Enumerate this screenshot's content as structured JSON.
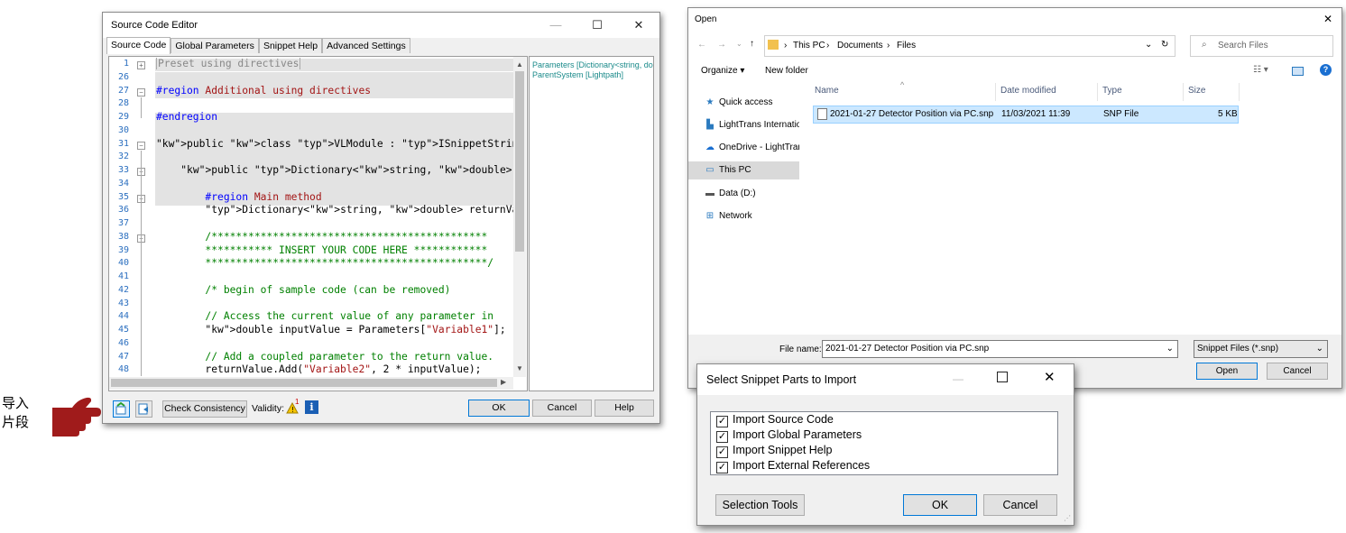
{
  "annotation": {
    "line1": "导入",
    "line2": "片段",
    "pointer_icon": "pointing-hand-icon",
    "pointer_color": "#a01b1b"
  },
  "editor": {
    "title": "Source Code Editor",
    "tabs": [
      "Source Code",
      "Global Parameters",
      "Snippet Help",
      "Advanced Settings"
    ],
    "lines": [
      {
        "n": "1",
        "text": "Preset using directives"
      },
      {
        "n": "26",
        "text": ""
      },
      {
        "n": "27",
        "text": "#region Additional using directives"
      },
      {
        "n": "28",
        "text": ""
      },
      {
        "n": "29",
        "text": "#endregion"
      },
      {
        "n": "30",
        "text": ""
      },
      {
        "n": "31",
        "text": "public class VLModule : ISnippetStringDoubleDictionary_S"
      },
      {
        "n": "32",
        "text": ""
      },
      {
        "n": "33",
        "text": "    public Dictionary<string, double> GetOutputParameter"
      },
      {
        "n": "34",
        "text": ""
      },
      {
        "n": "35",
        "text": "        #region Main method"
      },
      {
        "n": "36",
        "text": "        Dictionary<string, double> returnValue = new Dic"
      },
      {
        "n": "37",
        "text": ""
      },
      {
        "n": "38",
        "text": "        /*********************************************"
      },
      {
        "n": "39",
        "text": "        *********** INSERT YOUR CODE HERE ************"
      },
      {
        "n": "40",
        "text": "        **********************************************/"
      },
      {
        "n": "41",
        "text": ""
      },
      {
        "n": "42",
        "text": "        /* begin of sample code (can be removed)"
      },
      {
        "n": "43",
        "text": ""
      },
      {
        "n": "44",
        "text": "        // Access the current value of any parameter in"
      },
      {
        "n": "45",
        "text": "        double inputValue = Parameters[\"Variable1\"];"
      },
      {
        "n": "46",
        "text": ""
      },
      {
        "n": "47",
        "text": "        // Add a coupled parameter to the return value."
      },
      {
        "n": "48",
        "text": "        returnValue.Add(\"Variable2\", 2 * inputValue);"
      }
    ],
    "right_pane": [
      "Parameters [Dictionary<string, do",
      "ParentSystem [Lightpath]"
    ],
    "check_consistency": "Check Consistency",
    "validity_label": "Validity:",
    "validity_count": "1",
    "ok": "OK",
    "cancel": "Cancel",
    "help": "Help"
  },
  "open_dialog": {
    "title": "Open",
    "breadcrumb": [
      "This PC",
      "Documents",
      "Files"
    ],
    "search_placeholder": "Search Files",
    "organize": "Organize",
    "new_folder": "New folder",
    "sidebar": [
      {
        "label": "Quick access",
        "icon": "star-icon"
      },
      {
        "label": "LightTrans International",
        "icon": "building-icon"
      },
      {
        "label": "OneDrive - LightTrans",
        "icon": "cloud-icon"
      },
      {
        "label": "This PC",
        "icon": "monitor-icon"
      },
      {
        "label": "Data (D:)",
        "icon": "drive-icon"
      },
      {
        "label": "Network",
        "icon": "network-icon"
      }
    ],
    "columns": [
      "Name",
      "Date modified",
      "Type",
      "Size"
    ],
    "files": [
      {
        "name": "2021-01-27 Detector Position via PC.snp",
        "modified": "11/03/2021 11:39",
        "type": "SNP File",
        "size": "5 KB"
      }
    ],
    "file_name_label": "File name:",
    "file_name_value": "2021-01-27 Detector Position via PC.snp",
    "filter": "Snippet Files (*.snp)",
    "open_button": "Open",
    "cancel_button": "Cancel"
  },
  "select_dialog": {
    "title": "Select Snippet Parts to Import",
    "options": [
      "Import Source Code",
      "Import Global Parameters",
      "Import Snippet Help",
      "Import External References"
    ],
    "selection_tools": "Selection Tools",
    "ok": "OK",
    "cancel": "Cancel"
  }
}
